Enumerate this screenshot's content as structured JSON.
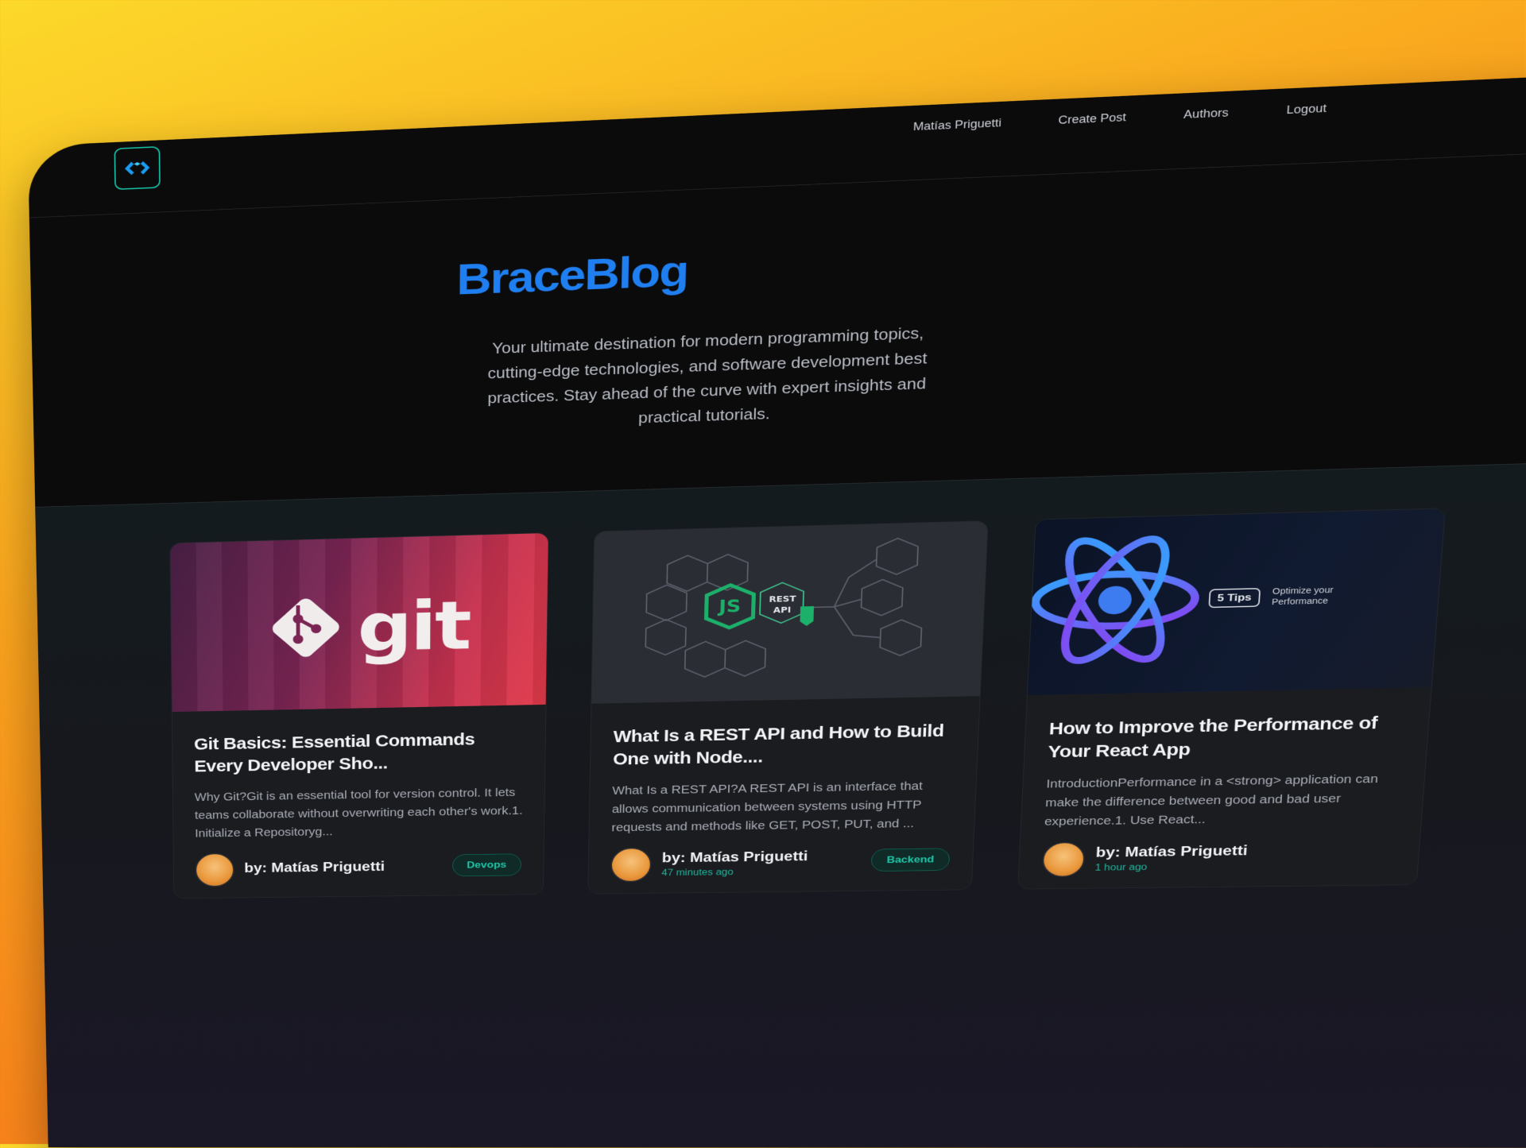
{
  "nav": {
    "links": [
      "Matías Priguetti",
      "Create Post",
      "Authors",
      "Logout"
    ]
  },
  "hero": {
    "title": "BraceBlog",
    "subtitle": "Your ultimate destination for modern programming topics, cutting-edge technologies, and software development best practices. Stay ahead of the curve with expert insights and practical tutorials."
  },
  "posts": [
    {
      "title": "Git Basics: Essential Commands Every Developer Sho...",
      "excerpt": "Why Git?Git is an essential tool for version control. It lets teams collaborate without overwriting each other's work.1. Initialize a Repositoryg...",
      "author": "by: Matías Priguetti",
      "time": "",
      "tag": "Devops",
      "thumb_text": "git"
    },
    {
      "title": "What Is a REST API and How to Build One with Node....",
      "excerpt": "What Is a REST API?A REST API is an interface that allows communication between systems using HTTP requests and methods like GET, POST, PUT, and ...",
      "author": "by: Matías Priguetti",
      "time": "47 minutes ago",
      "tag": "Backend",
      "thumb_labels": [
        "JS",
        "REST",
        "API"
      ]
    },
    {
      "title": "How to Improve the Performance of Your React App",
      "excerpt": "IntroductionPerformance in a <strong> application can make the difference between good and bad user experience.1. Use React...",
      "author": "by: Matías Priguetti",
      "time": "1 hour ago",
      "tag": "",
      "thumb_badge": "5 Tips",
      "thumb_caption": "Optimize your Performance"
    }
  ],
  "colors": {
    "accent": "#1f7ff0",
    "teal": "#19b69d",
    "background": "#0b0b0c"
  }
}
